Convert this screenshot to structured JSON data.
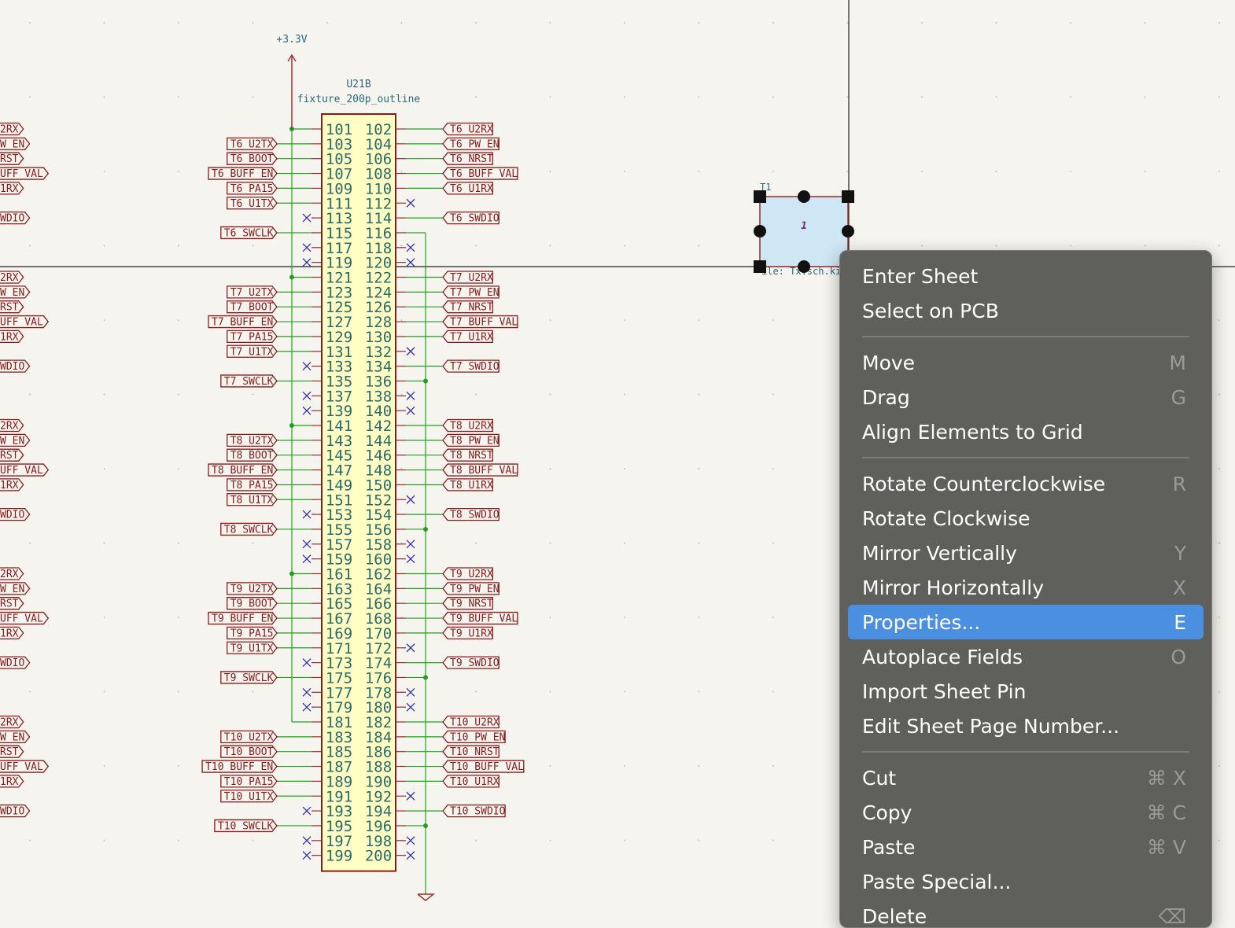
{
  "schematic": {
    "power_label": "+3.3V",
    "symbol_ref": "U21B",
    "symbol_value": "fixture_200p_outline",
    "pin_start": 101,
    "pin_end": 200,
    "groups": [
      {
        "left": {
          "U2TX": "T6_U2TX",
          "BOOT": "T6_BOOT",
          "BUFF_EN": "T6_BUFF_EN",
          "PA15": "T6_PA15",
          "U1TX": "T6_U1TX",
          "SWCLK": "T6_SWCLK"
        },
        "right": {
          "U2RX": "T6_U2RX",
          "PW_EN": "T6_PW_EN",
          "NRST": "T6_NRST",
          "BUFF_VAL": "T6_BUFF_VAL",
          "U1RX": "T6_U1RX",
          "SWDIO": "T6_SWDIO"
        }
      },
      {
        "left": {
          "U2TX": "T7_U2TX",
          "BOOT": "T7_BOOT",
          "BUFF_EN": "T7_BUFF_EN",
          "PA15": "T7_PA15",
          "U1TX": "T7_U1TX",
          "SWCLK": "T7_SWCLK"
        },
        "right": {
          "U2RX": "T7_U2RX",
          "PW_EN": "T7_PW_EN",
          "NRST": "T7_NRST",
          "BUFF_VAL": "T7_BUFF_VAL",
          "U1RX": "T7_U1RX",
          "SWDIO": "T7_SWDIO"
        }
      },
      {
        "left": {
          "U2TX": "T8_U2TX",
          "BOOT": "T8_BOOT",
          "BUFF_EN": "T8_BUFF_EN",
          "PA15": "T8_PA15",
          "U1TX": "T8_U1TX",
          "SWCLK": "T8_SWCLK"
        },
        "right": {
          "U2RX": "T8_U2RX",
          "PW_EN": "T8_PW_EN",
          "NRST": "T8_NRST",
          "BUFF_VAL": "T8_BUFF_VAL",
          "U1RX": "T8_U1RX",
          "SWDIO": "T8_SWDIO"
        }
      },
      {
        "left": {
          "U2TX": "T9_U2TX",
          "BOOT": "T9_BOOT",
          "BUFF_EN": "T9_BUFF_EN",
          "PA15": "T9_PA15",
          "U1TX": "T9_U1TX",
          "SWCLK": "T9_SWCLK"
        },
        "right": {
          "U2RX": "T9_U2RX",
          "PW_EN": "T9_PW_EN",
          "NRST": "T9_NRST",
          "BUFF_VAL": "T9_BUFF_VAL",
          "U1RX": "T9_U1RX",
          "SWDIO": "T9_SWDIO"
        }
      },
      {
        "left": {
          "U2TX": "T10_U2TX",
          "BOOT": "T10_BOOT",
          "BUFF_EN": "T10_BUFF_EN",
          "PA15": "T10_PA15",
          "U1TX": "T10_U1TX",
          "SWCLK": "T10_SWCLK"
        },
        "right": {
          "U2RX": "T10_U2RX",
          "PW_EN": "T10_PW_EN",
          "NRST": "T10_NRST",
          "BUFF_VAL": "T10_BUFF_VAL",
          "U1RX": "T10_U1RX",
          "SWDIO": "T10_SWDIO"
        }
      }
    ],
    "offscreen_left_labels": [
      "2RX",
      "W_EN",
      "RST",
      "UFF_VAL",
      "1RX",
      "WDIO"
    ],
    "sheet": {
      "reference": "T1",
      "page_number": "1",
      "file_text": "ile: Tx.sch.ki"
    }
  },
  "context_menu": {
    "items": [
      {
        "name": "enter-sheet",
        "label": "Enter Sheet",
        "shortcut": ""
      },
      {
        "name": "select-on-pcb",
        "label": "Select on PCB",
        "shortcut": ""
      },
      {
        "separator": true
      },
      {
        "name": "move",
        "label": "Move",
        "shortcut": "M"
      },
      {
        "name": "drag",
        "label": "Drag",
        "shortcut": "G"
      },
      {
        "name": "align-elements-to-grid",
        "label": "Align Elements to Grid",
        "shortcut": ""
      },
      {
        "separator": true
      },
      {
        "name": "rotate-counterclockwise",
        "label": "Rotate Counterclockwise",
        "shortcut": "R"
      },
      {
        "name": "rotate-clockwise",
        "label": "Rotate Clockwise",
        "shortcut": ""
      },
      {
        "name": "mirror-vertically",
        "label": "Mirror Vertically",
        "shortcut": "Y"
      },
      {
        "name": "mirror-horizontally",
        "label": "Mirror Horizontally",
        "shortcut": "X"
      },
      {
        "name": "properties",
        "label": "Properties...",
        "shortcut": "E",
        "highlighted": true
      },
      {
        "name": "autoplace-fields",
        "label": "Autoplace Fields",
        "shortcut": "O"
      },
      {
        "name": "import-sheet-pin",
        "label": "Import Sheet Pin",
        "shortcut": ""
      },
      {
        "name": "edit-sheet-page-number",
        "label": "Edit Sheet Page Number...",
        "shortcut": ""
      },
      {
        "separator": true
      },
      {
        "name": "cut",
        "label": "Cut",
        "shortcut": "⌘ X"
      },
      {
        "name": "copy",
        "label": "Copy",
        "shortcut": "⌘ C"
      },
      {
        "name": "paste",
        "label": "Paste",
        "shortcut": "⌘ V"
      },
      {
        "name": "paste-special",
        "label": "Paste Special...",
        "shortcut": ""
      },
      {
        "name": "delete",
        "label": "Delete",
        "shortcut": "⌫"
      }
    ]
  },
  "colors": {
    "background": "#f5f4ef",
    "wire": "#20a020",
    "pin": "#9b2a2a",
    "label": "#8a1a1a",
    "symbol_fill": "#ffffc4",
    "symbol_border": "#8a1a1a",
    "pin_number": "#2a6a6a",
    "power": "#a03030",
    "no_connect": "#3030b0",
    "field_text": "#2a6a7a",
    "sheet_fill": "#cfe6f5",
    "menu_highlight": "#4b8fe0"
  }
}
